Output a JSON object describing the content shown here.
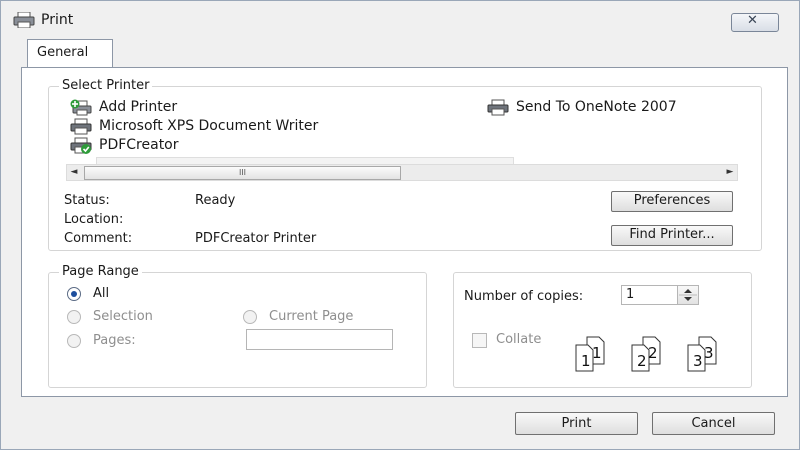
{
  "window": {
    "title": "Print",
    "close_symbol": "✕"
  },
  "tabs": [
    {
      "label": "General"
    }
  ],
  "select_printer": {
    "legend": "Select Printer",
    "printers": [
      {
        "name": "Add Printer",
        "icon": "add-printer-icon"
      },
      {
        "name": "Microsoft XPS Document Writer",
        "icon": "printer-icon"
      },
      {
        "name": "PDFCreator",
        "icon": "default-printer-icon",
        "selected": true
      },
      {
        "name": "Send To OneNote 2007",
        "icon": "printer-icon"
      }
    ],
    "scrollbar": {
      "left_arrow": "◄",
      "right_arrow": "►",
      "thumb_grip": "III"
    },
    "status_label": "Status:",
    "status_value": "Ready",
    "location_label": "Location:",
    "location_value": "",
    "comment_label": "Comment:",
    "comment_value": "PDFCreator Printer",
    "preferences_button": "Preferences",
    "find_printer_button": "Find Printer..."
  },
  "page_range": {
    "legend": "Page Range",
    "options": [
      {
        "label": "All",
        "selected": true,
        "enabled": true
      },
      {
        "label": "Selection",
        "selected": false,
        "enabled": false
      },
      {
        "label": "Current Page",
        "selected": false,
        "enabled": false
      },
      {
        "label": "Pages:",
        "selected": false,
        "enabled": false
      }
    ],
    "pages_value": ""
  },
  "copies": {
    "label": "Number of copies:",
    "value": "1",
    "collate_label": "Collate",
    "collate_checked": false,
    "collate_digits": [
      "1",
      "1",
      "2",
      "2",
      "3",
      "3"
    ]
  },
  "footer": {
    "print_button": "Print",
    "cancel_button": "Cancel"
  },
  "colors": {
    "accent": "#1e4f9e",
    "window_bg": "#f0f0f0",
    "panel_bg": "#ffffff"
  }
}
